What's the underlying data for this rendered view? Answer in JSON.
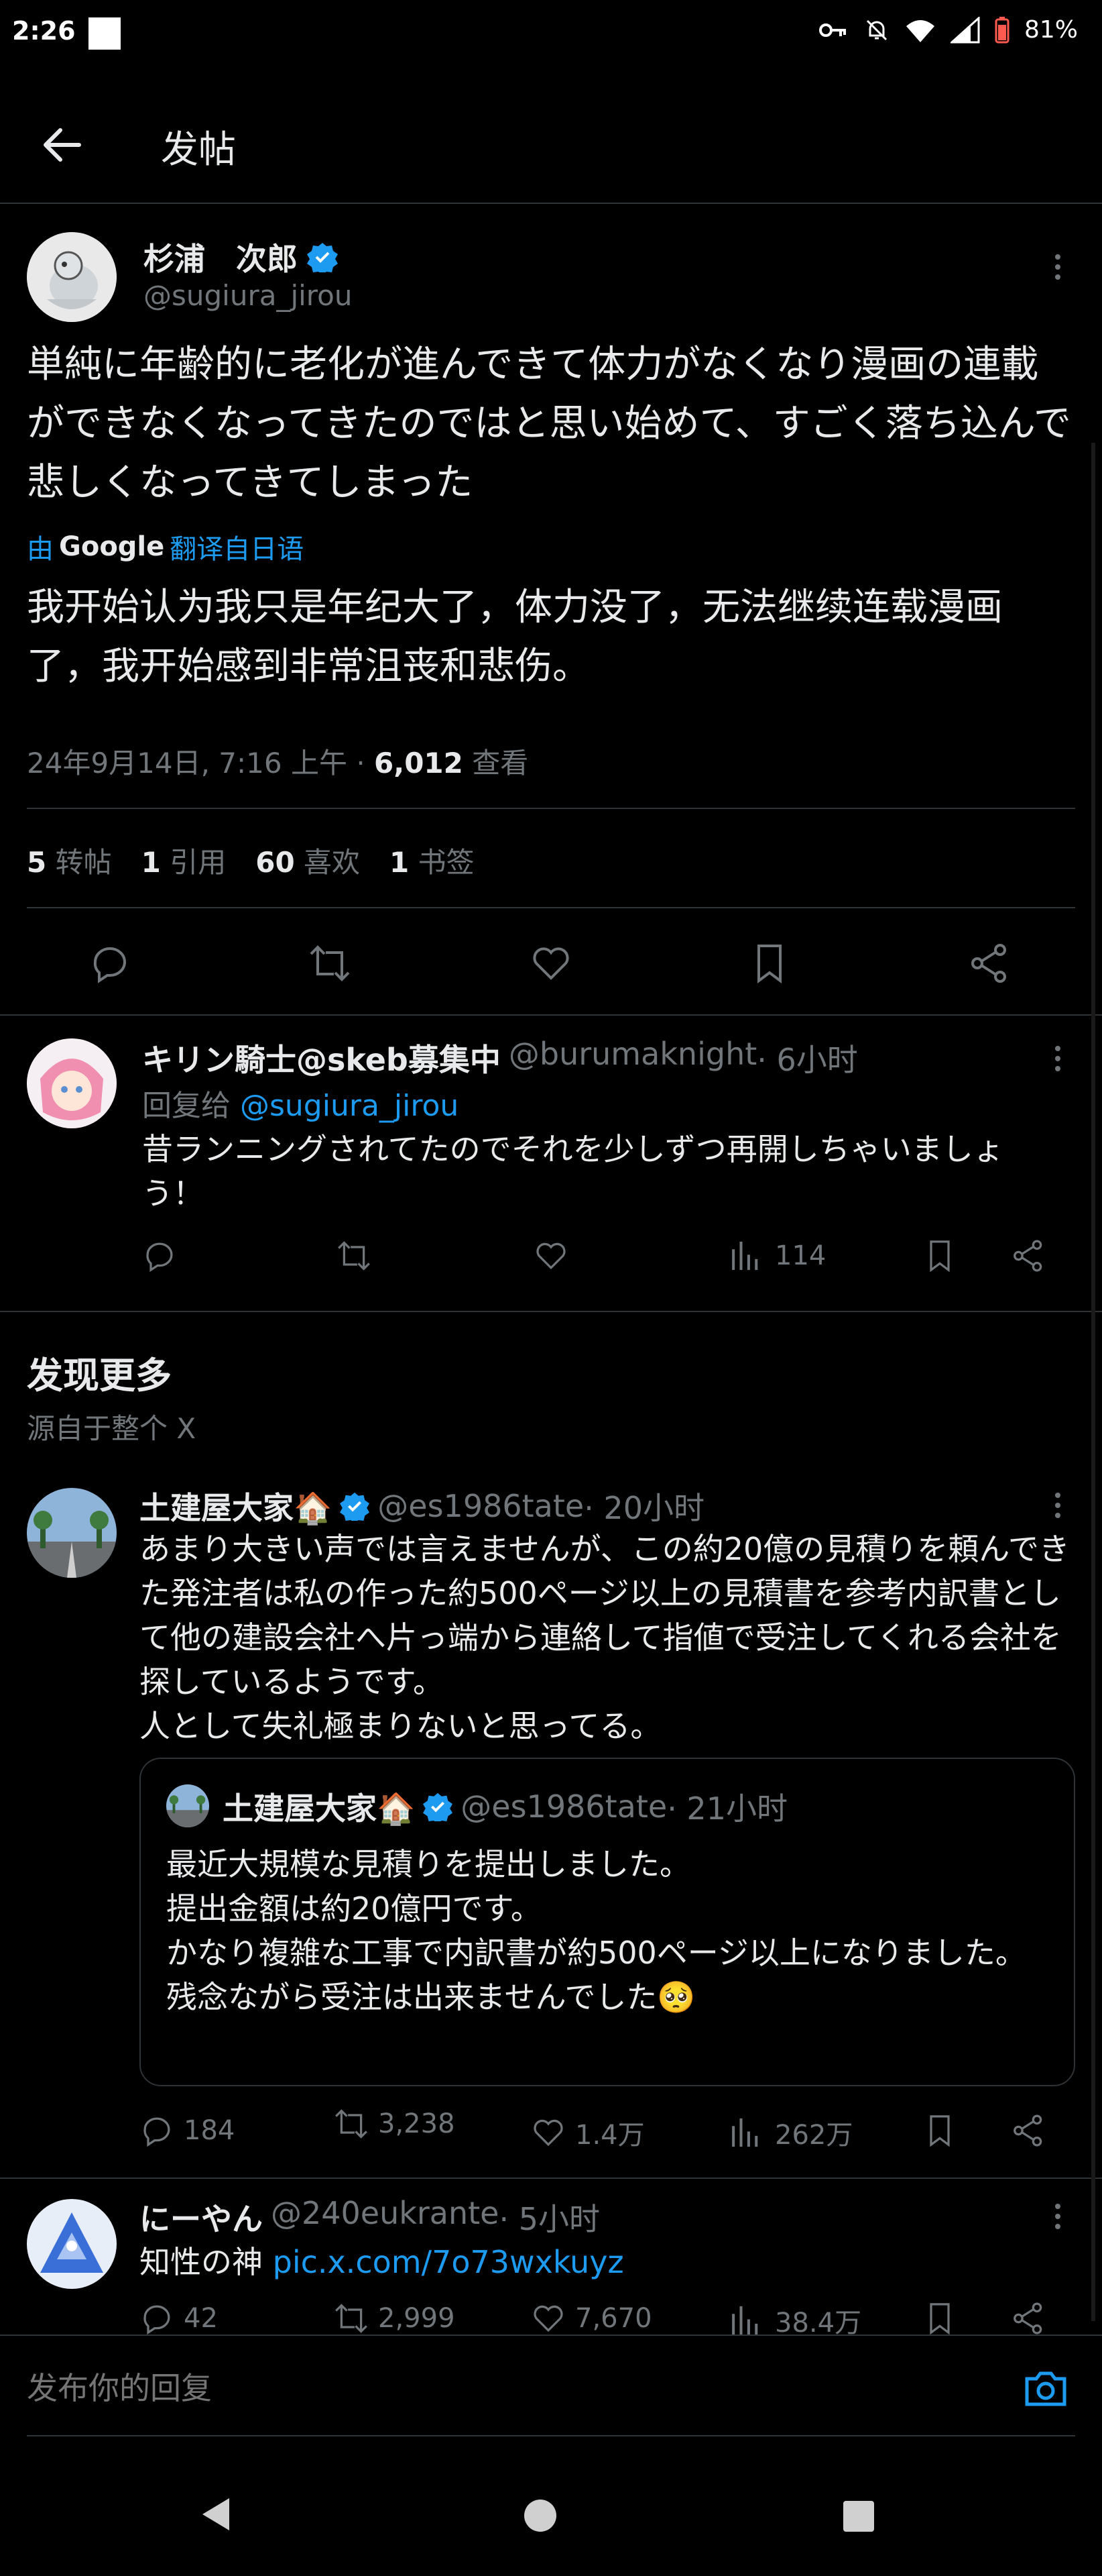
{
  "status_bar": {
    "time": "2:26",
    "battery": "81%"
  },
  "header": {
    "title": "发帖"
  },
  "main_post": {
    "display_name": "杉浦　次郎",
    "handle": "@sugiura_jirou",
    "text_original": "単純に年齢的に老化が進んできて体力がなくなり漫画の連載ができなくなってきたのではと思い始めて、すごく落ち込んで悲しくなってきてしまった",
    "translate_prefix": "由",
    "translate_brand": "Google",
    "translate_suffix": "翻译自日语",
    "text_translated": "我开始认为我只是年纪大了，体力没了，无法继续连载漫画了，我开始感到非常沮丧和悲伤。",
    "timestamp": "24年9月14日, 7:16 上午 · ",
    "views_count": "6,012",
    "views_label": " 查看",
    "stats": {
      "reposts_count": "5",
      "reposts_label": "转帖",
      "quotes_count": "1",
      "quotes_label": "引用",
      "likes_count": "60",
      "likes_label": "喜欢",
      "bookmarks_count": "1",
      "bookmarks_label": "书签"
    }
  },
  "reply": {
    "display_name": "キリン騎士@skeb募集中",
    "handle": "@burumaknight",
    "time": " · 6小时",
    "reply_to_prefix": "回复给 ",
    "reply_to_handle": "@sugiura_jirou",
    "text": "昔ランニングされてたのでそれを少しずつ再開しちゃいましょう！",
    "views": "114"
  },
  "discover": {
    "title": "发现更多",
    "subtitle": "源自于整个 X"
  },
  "feed_post_1": {
    "display_name": "土建屋大家🏠",
    "handle": "@es1986tate",
    "time": " · 20小时",
    "text": "あまり大きい声では言えませんが、この約20億の見積りを頼んできた発注者は私の作った約500ページ以上の見積書を参考内訳書として他の建設会社へ片っ端から連絡して指値で受注してくれる会社を探しているようです。\n人として失礼極まりないと思ってる。",
    "quote": {
      "display_name": "土建屋大家🏠",
      "handle": "@es1986tate",
      "time": " · 21小时",
      "text": "最近大規模な見積りを提出しました。\n提出金額は約20億円です。\nかなり複雑な工事で内訳書が約500ページ以上になりました。\n残念ながら受注は出来ませんでした🥺"
    },
    "replies": "184",
    "reposts": "3,238",
    "likes": "1.4万",
    "views": "262万"
  },
  "feed_post_2": {
    "display_name": "にーやん",
    "handle": "@240eukrante",
    "time": " · 5小时",
    "text_prefix": "知性の神 ",
    "link": "pic.x.com/7o73wxkuyz",
    "replies": "42",
    "reposts": "2,999",
    "likes": "7,670",
    "views": "38.4万"
  },
  "compose": {
    "placeholder": "发布你的回复"
  },
  "colors": {
    "accent": "#1d9bf0",
    "background": "#000000",
    "text": "#e7e9ea",
    "muted": "#71767b",
    "divider": "#2f3336"
  }
}
